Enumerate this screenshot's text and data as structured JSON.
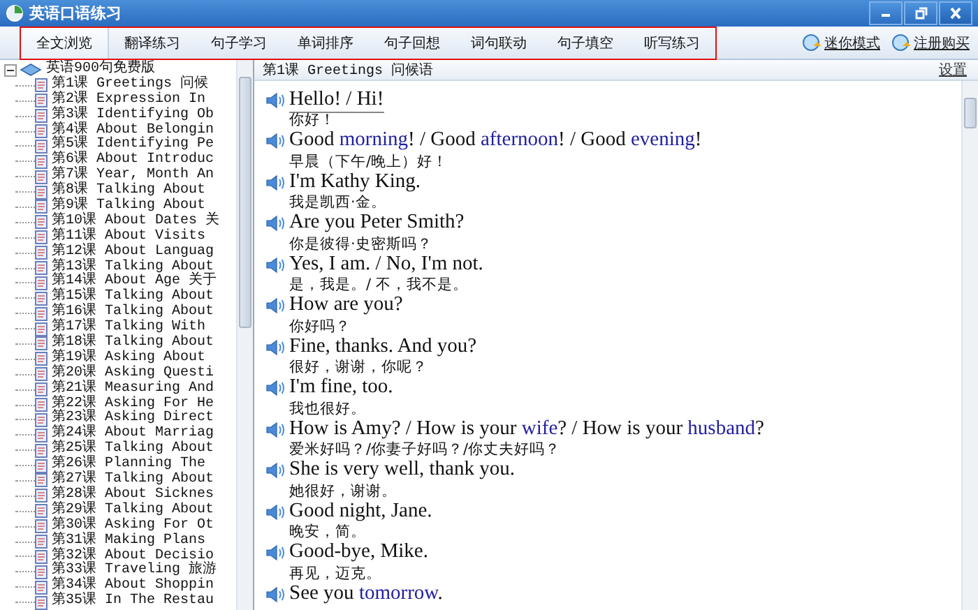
{
  "window": {
    "title": "英语口语练习"
  },
  "toolbar": {
    "outlined": true,
    "tabs": [
      {
        "label": "全文浏览",
        "selected": true
      },
      {
        "label": "翻译练习",
        "selected": false
      },
      {
        "label": "句子学习",
        "selected": false
      },
      {
        "label": "单词排序",
        "selected": false
      },
      {
        "label": "句子回想",
        "selected": false
      },
      {
        "label": "词句联动",
        "selected": false
      },
      {
        "label": "句子填空",
        "selected": false
      },
      {
        "label": "听写练习",
        "selected": false
      }
    ],
    "links": [
      "迷你模式",
      "注册购买"
    ]
  },
  "tree": {
    "root": {
      "label": "英语900句免费版",
      "expanded": true,
      "children": [
        {
          "label": "第1课 Greetings 问候"
        },
        {
          "label": "第2课 Expression In"
        },
        {
          "label": "第3课 Identifying Ob"
        },
        {
          "label": "第4课 About Belongin"
        },
        {
          "label": "第5课 Identifying Pe"
        },
        {
          "label": "第6课 About Introduc"
        },
        {
          "label": "第7课 Year, Month An"
        },
        {
          "label": "第8课 Talking About"
        },
        {
          "label": "第9课 Talking About"
        },
        {
          "label": "第10课 About Dates 关"
        },
        {
          "label": "第11课 About Visits"
        },
        {
          "label": "第12课 About Languag"
        },
        {
          "label": "第13课 Talking About"
        },
        {
          "label": "第14课 About Age 关于"
        },
        {
          "label": "第15课 Talking About"
        },
        {
          "label": "第16课 Talking About"
        },
        {
          "label": "第17课 Talking With"
        },
        {
          "label": "第18课 Talking About"
        },
        {
          "label": "第19课 Asking About"
        },
        {
          "label": "第20课 Asking Questi"
        },
        {
          "label": "第21课 Measuring And"
        },
        {
          "label": "第22课 Asking For He"
        },
        {
          "label": "第23课 Asking Direct"
        },
        {
          "label": "第24课 About Marriag"
        },
        {
          "label": "第25课 Talking About"
        },
        {
          "label": "第26课 Planning The"
        },
        {
          "label": "第27课 Talking About"
        },
        {
          "label": "第28课 About Sicknes"
        },
        {
          "label": "第29课 Talking About"
        },
        {
          "label": "第30课 Asking For Ot"
        },
        {
          "label": "第31课 Making Plans"
        },
        {
          "label": "第32课 About Decisio"
        },
        {
          "label": "第33课 Traveling 旅游"
        },
        {
          "label": "第34课 About Shoppin"
        },
        {
          "label": "第35课 In The Restau"
        }
      ]
    }
  },
  "content": {
    "heading": "第1课 Greetings 问候语",
    "settings_link": "设置",
    "sentences": [
      {
        "selected": true,
        "segments": [
          {
            "text": "Hello! / Hi!",
            "highlight": false
          }
        ],
        "translation": "你好！"
      },
      {
        "selected": false,
        "segments": [
          {
            "text": "Good ",
            "highlight": false
          },
          {
            "text": "morning",
            "highlight": true
          },
          {
            "text": "! / Good ",
            "highlight": false
          },
          {
            "text": "afternoon",
            "highlight": true
          },
          {
            "text": "! / Good ",
            "highlight": false
          },
          {
            "text": "evening",
            "highlight": true
          },
          {
            "text": "!",
            "highlight": false
          }
        ],
        "translation": "早晨（下午/晚上）好！"
      },
      {
        "selected": false,
        "segments": [
          {
            "text": "I'm Kathy King.",
            "highlight": false
          }
        ],
        "translation": "我是凯西·金。"
      },
      {
        "selected": false,
        "segments": [
          {
            "text": "Are you Peter Smith?",
            "highlight": false
          }
        ],
        "translation": "你是彼得·史密斯吗？"
      },
      {
        "selected": false,
        "segments": [
          {
            "text": "Yes, I am. / No, I'm not.",
            "highlight": false
          }
        ],
        "translation": "是，我是。/ 不，我不是。"
      },
      {
        "selected": false,
        "segments": [
          {
            "text": "How are you?",
            "highlight": false
          }
        ],
        "translation": "你好吗？"
      },
      {
        "selected": false,
        "segments": [
          {
            "text": "Fine, thanks. And you?",
            "highlight": false
          }
        ],
        "translation": "很好，谢谢，你呢？"
      },
      {
        "selected": false,
        "segments": [
          {
            "text": "I'm fine, too.",
            "highlight": false
          }
        ],
        "translation": "我也很好。"
      },
      {
        "selected": false,
        "segments": [
          {
            "text": "How is Amy? / How is your ",
            "highlight": false
          },
          {
            "text": "wife",
            "highlight": true
          },
          {
            "text": "? / How is your ",
            "highlight": false
          },
          {
            "text": "husband",
            "highlight": true
          },
          {
            "text": "?",
            "highlight": false
          }
        ],
        "translation": "爱米好吗？/你妻子好吗？/你丈夫好吗？"
      },
      {
        "selected": false,
        "segments": [
          {
            "text": "She is very well, thank you.",
            "highlight": false
          }
        ],
        "translation": "她很好，谢谢。"
      },
      {
        "selected": false,
        "segments": [
          {
            "text": "Good night, Jane.",
            "highlight": false
          }
        ],
        "translation": "晚安，简。"
      },
      {
        "selected": false,
        "segments": [
          {
            "text": "Good-bye, Mike.",
            "highlight": false
          }
        ],
        "translation": "再见，迈克。"
      },
      {
        "selected": false,
        "segments": [
          {
            "text": "See you ",
            "highlight": false
          },
          {
            "text": "tomorrow",
            "highlight": true
          },
          {
            "text": ".",
            "highlight": false
          }
        ]
      }
    ]
  }
}
